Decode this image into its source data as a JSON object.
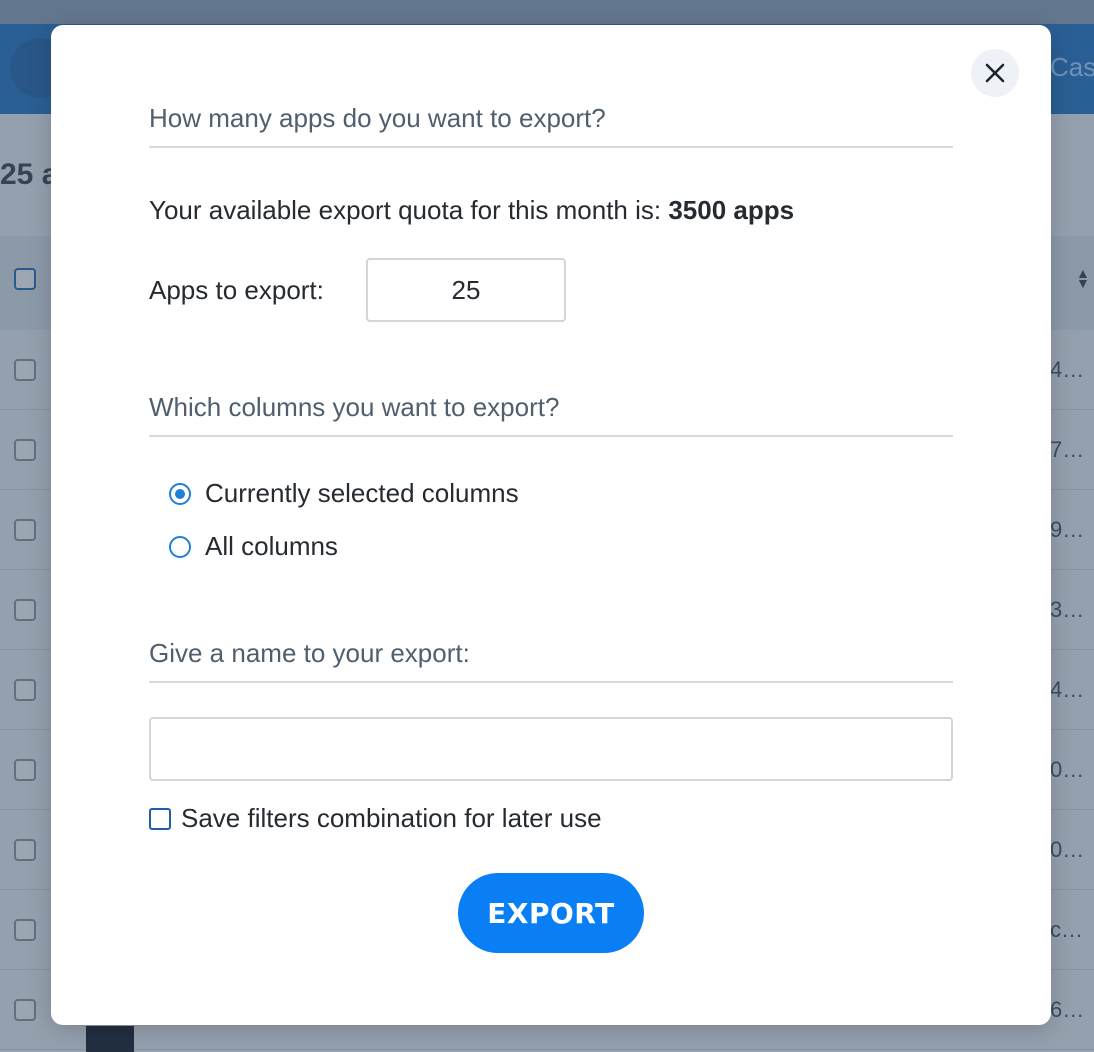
{
  "background": {
    "header_text": "Cas",
    "title": "25 a",
    "row_values": [
      "4…",
      "7…",
      "9…",
      "3…",
      "4…",
      "0…",
      "0…",
      "c…",
      "6…"
    ]
  },
  "modal": {
    "close_icon": "close-icon",
    "section_count": {
      "heading": "How many apps do you want to export?",
      "quota_text": "Your available export quota for this month is: ",
      "quota_value": "3500 apps",
      "apps_label": "Apps to export:",
      "apps_value": "25"
    },
    "section_columns": {
      "heading": "Which columns you want to export?",
      "options": [
        {
          "label": "Currently selected columns",
          "selected": true
        },
        {
          "label": "All columns",
          "selected": false
        }
      ]
    },
    "section_name": {
      "heading": "Give a name to your export:",
      "name_value": "",
      "save_filters_label": "Save filters combination for later use",
      "save_filters_checked": false
    },
    "export_label": "EXPORT"
  },
  "colors": {
    "accent": "#0a7ff5",
    "radio": "#1f7fd6",
    "heading_text": "#4f5f6e"
  }
}
